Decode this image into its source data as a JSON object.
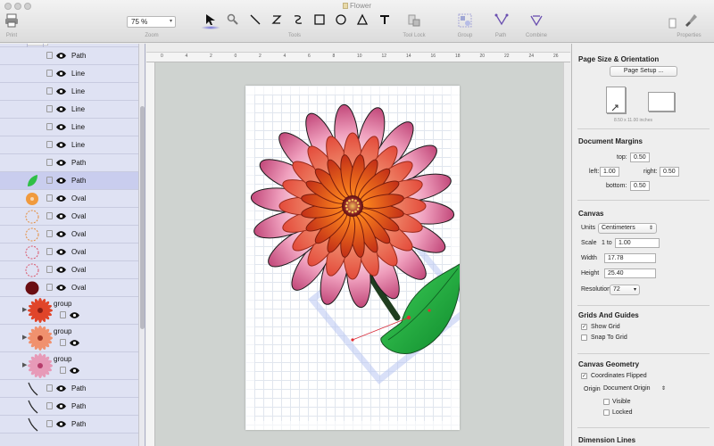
{
  "window": {
    "title": "Flower"
  },
  "toolbar": {
    "print_label": "Print",
    "zoom_value": "75 %",
    "zoom_label": "Zoom",
    "tools_label": "Tools",
    "tool_lock_label": "Tool Lock",
    "group_label": "Group",
    "path_label": "Path",
    "combine_label": "Combine",
    "properties_label": "Properties"
  },
  "layers": {
    "rows": [
      {
        "label": "Path"
      },
      {
        "label": "Line"
      },
      {
        "label": "Line"
      },
      {
        "label": "Line"
      },
      {
        "label": "Line"
      },
      {
        "label": "Line"
      },
      {
        "label": "Path"
      },
      {
        "label": "Path"
      },
      {
        "label": "Oval"
      },
      {
        "label": "Oval"
      },
      {
        "label": "Oval"
      },
      {
        "label": "Oval"
      },
      {
        "label": "Oval"
      },
      {
        "label": "Oval"
      }
    ],
    "groups": [
      {
        "label": "group"
      },
      {
        "label": "group"
      },
      {
        "label": "group"
      }
    ],
    "tail_rows": [
      {
        "label": "Path"
      },
      {
        "label": "Path"
      },
      {
        "label": "Path"
      }
    ]
  },
  "ruler": {
    "ticks": [
      "0",
      "4",
      "2",
      "0",
      "2",
      "4",
      "6",
      "8",
      "10",
      "12",
      "14",
      "16",
      "18",
      "20",
      "22",
      "24",
      "26"
    ]
  },
  "inspector": {
    "page_size": {
      "title": "Page Size & Orientation",
      "setup_button": "Page Setup ...",
      "size_text": "8.50 x 11.00 inches"
    },
    "margins": {
      "title": "Document Margins",
      "top_label": "top:",
      "top_value": "0.50",
      "left_label": "left:",
      "left_value": "1.00",
      "right_label": "right:",
      "right_value": "0.50",
      "bottom_label": "bottom:",
      "bottom_value": "0.50"
    },
    "canvas": {
      "title": "Canvas",
      "units_label": "Units",
      "units_value": "Centimeters",
      "scale_label": "Scale",
      "scale_prefix": "1 to",
      "scale_value": "1.00",
      "width_label": "Width",
      "width_value": "17.78",
      "height_label": "Height",
      "height_value": "25.40",
      "resolution_label": "Resolution",
      "resolution_value": "72"
    },
    "grids": {
      "title": "Grids And Guides",
      "show_grid_label": "Show Grid",
      "show_grid_checked": true,
      "snap_label": "Snap To Grid",
      "snap_checked": false
    },
    "geometry": {
      "title": "Canvas Geometry",
      "flipped_label": "Coordinates Flipped",
      "flipped_checked": true,
      "origin_label": "Origin",
      "origin_value": "Document Origin",
      "visible_label": "Visible",
      "locked_label": "Locked"
    },
    "dimension_lines": {
      "title": "Dimension Lines"
    }
  }
}
